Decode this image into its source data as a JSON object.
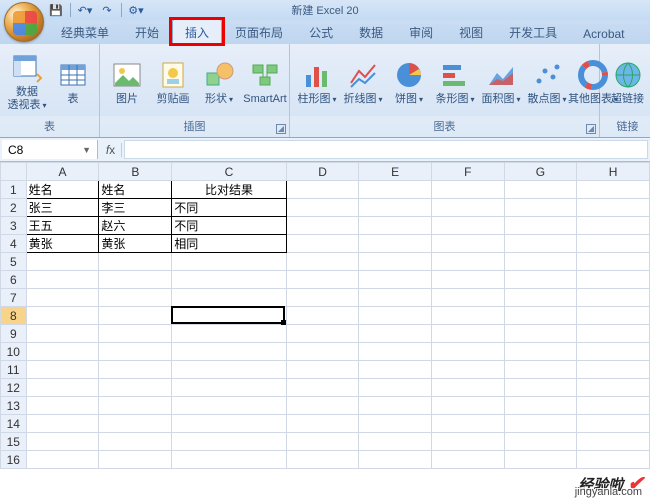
{
  "app_title": "新建 Excel 20",
  "qat": {
    "save_tip": "保存",
    "undo_tip": "撤销",
    "redo_tip": "重做"
  },
  "tabs": {
    "classic": "经典菜单",
    "home": "开始",
    "insert": "插入",
    "pagelayout": "页面布局",
    "formulas": "公式",
    "data": "数据",
    "review": "审阅",
    "view": "视图",
    "developer": "开发工具",
    "acrobat": "Acrobat"
  },
  "ribbon": {
    "groups": {
      "tables": {
        "label": "表",
        "pivot": "数据\n透视表",
        "table": "表"
      },
      "illust": {
        "label": "插图",
        "picture": "图片",
        "clipart": "剪贴画",
        "shapes": "形状",
        "smartart": "SmartArt"
      },
      "charts": {
        "label": "图表",
        "column": "柱形图",
        "line": "折线图",
        "pie": "饼图",
        "bar": "条形图",
        "area": "面积图",
        "scatter": "散点图",
        "other": "其他图表"
      },
      "links": {
        "label": "链接",
        "hyperlink": "超链接"
      }
    }
  },
  "namebox": "C8",
  "formula": "",
  "columns": [
    "A",
    "B",
    "C",
    "D",
    "E",
    "F",
    "G",
    "H"
  ],
  "rows": [
    1,
    2,
    3,
    4,
    5,
    6,
    7,
    8,
    9,
    10,
    11,
    12,
    13,
    14,
    15,
    16
  ],
  "table": {
    "cols": [
      "姓名",
      "姓名",
      "比对结果"
    ],
    "rows": [
      [
        "张三",
        "李三",
        "不同"
      ],
      [
        "王五",
        "赵六",
        "不同"
      ],
      [
        "黄张",
        "黄张",
        "相同"
      ]
    ]
  },
  "active_cell": {
    "row": 8,
    "col": "C"
  },
  "watermark": {
    "brand": "经验啦",
    "url": "jingyanla.com"
  }
}
